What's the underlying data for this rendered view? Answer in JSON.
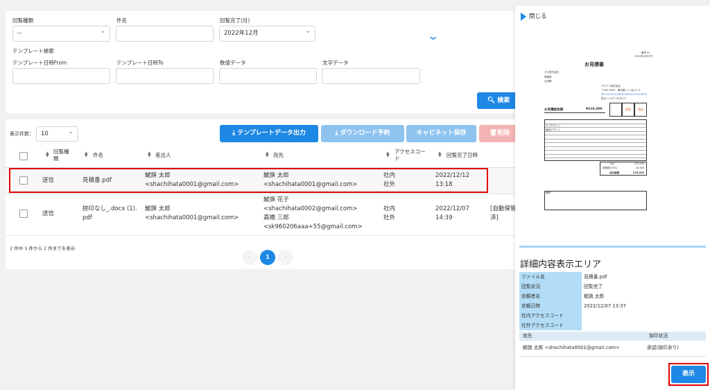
{
  "search": {
    "circulation_type_label": "回覧種類",
    "circulation_type_value": "--",
    "subject_label": "件名",
    "subject_value": "",
    "completed_month_label": "回覧完了(月)",
    "completed_month_value": "2022年12月",
    "template_search_label": "テンプレート検索",
    "template_date_from_label": "テンプレート日時From",
    "template_date_to_label": "テンプレート日時To",
    "numeric_data_label": "数値データ",
    "text_data_label": "文字データ",
    "search_button": "検索",
    "expand_icon": "chevron-down-icon"
  },
  "results": {
    "page_size_label": "表示件数：",
    "page_size_value": "10",
    "buttons": {
      "template_export": "テンプレートデータ出力",
      "download_reserve": "ダウンロード予約",
      "cabinet_save": "キャビネット保存",
      "delete": "削除"
    },
    "columns": [
      "回覧種類",
      "件名",
      "差出人",
      "宛先",
      "アクセスコード",
      "回覧完了日時"
    ],
    "rows": [
      {
        "type": "送信",
        "subject": "見積書.pdf",
        "sender_name": "鯱旗 太郎",
        "sender_email": "<shachihata0001@gmail.com>",
        "recipients": [
          "鯱旗 太郎",
          "<shachihata0001@gmail.com>"
        ],
        "access": [
          "社内",
          "社外"
        ],
        "completed": [
          "2022/12/12",
          "13:18"
        ],
        "extra": ""
      },
      {
        "type": "送信",
        "subject_line1": "捺印なし_.docx (1).",
        "subject_line2": "pdf",
        "sender_name": "鯱旗 太郎",
        "sender_email": "<shachihata0001@gmail.com>",
        "recipients": [
          "鯱旗 花子",
          "<shachihata0002@gmail.com>",
          "高橋 三郎",
          "<sk960206aaa+55@gmail.com>"
        ],
        "access": [
          "社内",
          "社外"
        ],
        "completed": [
          "2022/12/07",
          "14:39"
        ],
        "extra": [
          "[自動保管",
          "済]"
        ]
      }
    ],
    "summary": "2 件中 1 件から 2 件までを表示",
    "pagination": {
      "prev": "‹",
      "current": "1",
      "next": "›"
    }
  },
  "panel": {
    "close_label": "閉じる",
    "preview": {
      "doc_no": "番号 01",
      "doc_date": "2021年4月30日",
      "title": "お見積書",
      "to_company": "〇〇株式会社",
      "to_1": "総務部",
      "to_2": "山田様",
      "from_company": "デモアジ株式会社",
      "from_addr": "〒000-0000　東京都○○○区1-2-3",
      "from_tel": "TEL:03-1234-5678 FAX:03-1234-5679",
      "from_person": "担当 シヤチハタタロウ",
      "total_label": "お見積総金額",
      "total_value": "¥218,000",
      "stamp_1": "承認",
      "stamp_2": "承認",
      "sum_label": "合計金額",
      "sum_value": "218,000",
      "subtotal_label": "小計",
      "subtotal_value": "200,000",
      "tax_label": "消費税(10%)",
      "tax_value": "18,000",
      "item_1": "ロゴデザイン",
      "item_2": "製品デザイン",
      "notes": "備考"
    },
    "detail_title": "詳細内容表示エリア",
    "details": [
      {
        "key": "ファイル名",
        "value": "見積書.pdf"
      },
      {
        "key": "回覧状況",
        "value": "回覧完了"
      },
      {
        "key": "依頼者名",
        "value": "鯱旗 太郎"
      },
      {
        "key": "依頼日時",
        "value": "2022/12/07 13:37"
      },
      {
        "key": "社内アクセスコード",
        "value": ""
      },
      {
        "key": "社外アクセスコード",
        "value": ""
      }
    ],
    "recipient_header": "宛先",
    "stamp_status_header": "捺印状況",
    "recipient_value": "鯱旗 太郎 <shachihata0001@gmail.com>",
    "stamp_status_value": "承認(捺印あり)",
    "show_button": "表示"
  }
}
